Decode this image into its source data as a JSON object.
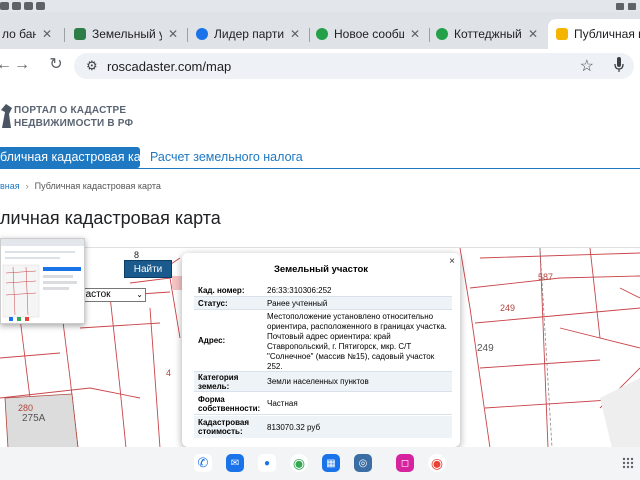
{
  "browser": {
    "tabs": [
      {
        "title": "ло банкро",
        "active": false,
        "favicon_color": "#e8b04a"
      },
      {
        "title": "Земельный участ",
        "active": false,
        "favicon_color": "#2d7d46"
      },
      {
        "title": "Лидер партии «Т",
        "active": false,
        "favicon_color": "#1a73e8"
      },
      {
        "title": "Новое сообщени",
        "active": false,
        "favicon_color": "#24a148"
      },
      {
        "title": "Коттеджный пос",
        "active": false,
        "favicon_color": "#24a148"
      },
      {
        "title": "Публичная када",
        "active": true,
        "favicon_color": "#f4b400"
      }
    ],
    "tab_close_glyph": "✕",
    "url": "roscadaster.com/map",
    "back_glyph": "←",
    "forward_glyph": "→",
    "reload_glyph": "↻",
    "bookmark_glyph": "☆",
    "site_info_glyph": "⚙"
  },
  "site": {
    "logo_line1": "ПОРТАЛ О КАДАСТРЕ",
    "logo_line2": "НЕДВИЖИМОСТИ В РФ",
    "nav_active": "бличная кадастровая карта",
    "nav_link": "Расчет земельного налога",
    "breadcrumb_home": "вная",
    "breadcrumb_sep": "›",
    "breadcrumb_current": "Публичная кадастровая карта",
    "page_title": "личная кадастровая карта"
  },
  "map": {
    "find_button": "Найти",
    "select_value": "й участок",
    "select_arrow": "⌄",
    "labels": [
      {
        "text": "8",
        "color": "#333333"
      },
      {
        "text": "4",
        "color": "#b0443c"
      },
      {
        "text": "280",
        "color": "#b0443c"
      },
      {
        "text": "275А",
        "color": "#555555"
      },
      {
        "text": "587",
        "color": "#b0443c"
      },
      {
        "text": "249",
        "color": "#b0443c"
      },
      {
        "text": "249",
        "color": "#555555"
      }
    ]
  },
  "popup": {
    "title": "Земельный участок",
    "close_glyph": "×",
    "rows": [
      {
        "label": "Кад. номер:",
        "value": "26:33:310306:252"
      },
      {
        "label": "Статус:",
        "value": "Ранее учтенный"
      },
      {
        "label": "Адрес:",
        "value": "Местоположение установлено относительно ориентира, расположенного в границах участка. Почтовый адрес ориентира: край Ставропольский, г. Пятигорск, мкр. С/Т \"Солнечное\" (массив №15), садовый участок 252."
      },
      {
        "label": "Категория земель:",
        "value": "Земли населенных пунктов"
      },
      {
        "label": "Форма собственности:",
        "value": "Частная"
      },
      {
        "label": "Кадастровая стоимость:",
        "value": "813070.32 руб"
      }
    ]
  },
  "dock": {
    "apps": [
      {
        "name": "phone",
        "color": "#1a73e8",
        "glyph": "✆"
      },
      {
        "name": "messages",
        "color": "#1a73e8",
        "glyph": "✉"
      },
      {
        "name": "contacts",
        "color": "#1a73e8",
        "glyph": "●"
      },
      {
        "name": "chrome",
        "color": "#34a853",
        "glyph": "◉"
      },
      {
        "name": "files",
        "color": "#1a73e8",
        "glyph": "▦"
      },
      {
        "name": "camera",
        "color": "#3a6ea5",
        "glyph": "◎"
      },
      {
        "name": "instagram",
        "color": "#d6249f",
        "glyph": "◻"
      },
      {
        "name": "chrome-2",
        "color": "#ea4335",
        "glyph": "◉"
      }
    ]
  },
  "colors": {
    "accent": "#1e78c2",
    "find_button": "#1a5a8c",
    "parcel_line": "#c9454a"
  }
}
